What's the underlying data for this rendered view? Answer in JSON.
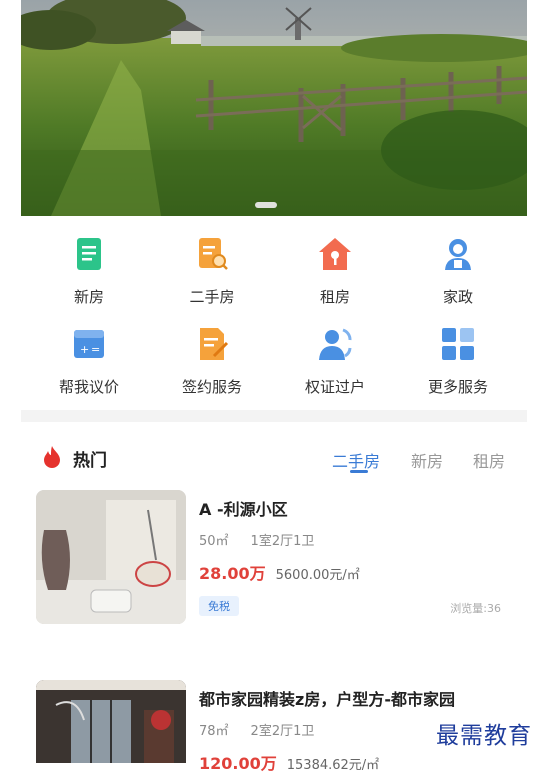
{
  "grid": {
    "row1": [
      {
        "label": "新房",
        "icon": "new-house-icon"
      },
      {
        "label": "二手房",
        "icon": "second-hand-house-icon"
      },
      {
        "label": "租房",
        "icon": "rent-house-icon"
      },
      {
        "label": "家政",
        "icon": "housekeeping-icon"
      }
    ],
    "row2": [
      {
        "label": "帮我议价",
        "icon": "calculator-icon"
      },
      {
        "label": "签约服务",
        "icon": "contract-icon"
      },
      {
        "label": "权证过户",
        "icon": "transfer-icon"
      },
      {
        "label": "更多服务",
        "icon": "more-services-icon"
      }
    ]
  },
  "hot": {
    "title": "热门",
    "tabs": [
      "二手房",
      "新房",
      "租房"
    ],
    "active_tab": "二手房"
  },
  "listings": [
    {
      "title": "A -利源小区",
      "area": "50㎡",
      "layout": "1室2厅1卫",
      "price": "28.00万",
      "unit_price": "5600.00元/㎡",
      "tag": "免税",
      "views": "浏览量:36"
    },
    {
      "title": "都市家园精装z房，户型方-都市家园",
      "area": "78㎡",
      "layout": "2室2厅1卫",
      "price": "120.00万",
      "unit_price": "15384.62元/㎡"
    }
  ],
  "watermark": "最需教育",
  "colors": {
    "accent": "#3a7bd5",
    "price": "#e0413a"
  }
}
